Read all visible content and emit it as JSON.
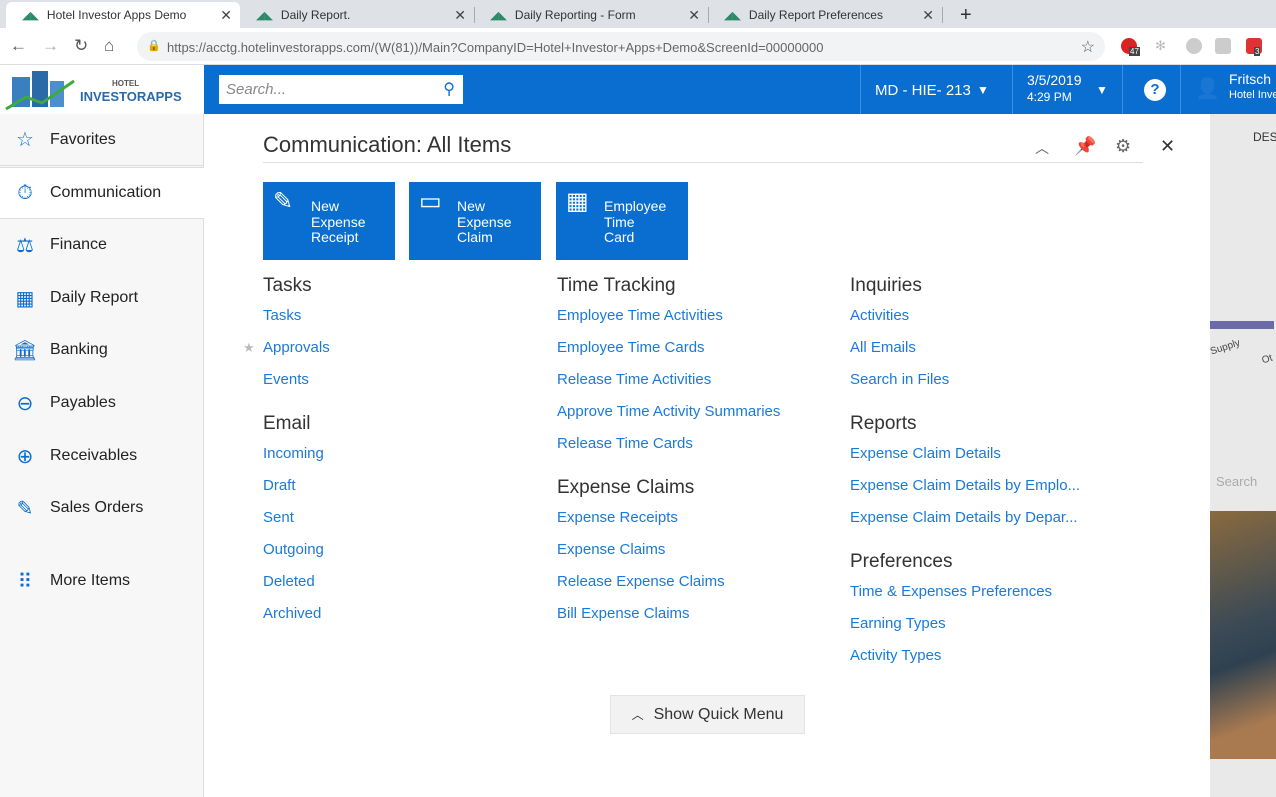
{
  "browser": {
    "tabs": [
      {
        "title": "Hotel Investor Apps Demo",
        "active": true
      },
      {
        "title": "Daily Report."
      },
      {
        "title": "Daily Reporting - Form"
      },
      {
        "title": "Daily Report Preferences"
      }
    ],
    "url_host": "https://acctg.hotelinvestorapps.com",
    "url_rest": "/(W(81))/Main?CompanyID=Hotel+Investor+Apps+Demo&ScreenId=00000000",
    "ext_badges": [
      "47",
      "3"
    ]
  },
  "header": {
    "logo_top": "HOTEL",
    "logo_bottom": "INVESTORAPPS",
    "search_placeholder": "Search...",
    "branch": "MD - HIE- 213",
    "date": "3/5/2019",
    "time": "4:29 PM",
    "user_name": "Fritsch",
    "user_company": "Hotel Inve"
  },
  "sidebar": {
    "items": [
      {
        "label": "Favorites",
        "icon": "star-icon"
      },
      {
        "label": "Communication",
        "icon": "timer-icon"
      },
      {
        "label": "Finance",
        "icon": "scale-icon"
      },
      {
        "label": "Daily Report",
        "icon": "building-icon"
      },
      {
        "label": "Banking",
        "icon": "bank-icon"
      },
      {
        "label": "Payables",
        "icon": "minus-circle-icon"
      },
      {
        "label": "Receivables",
        "icon": "plus-circle-icon"
      },
      {
        "label": "Sales Orders",
        "icon": "edit-icon"
      },
      {
        "label": "More Items",
        "icon": "grid-icon"
      }
    ]
  },
  "panel": {
    "title": "Communication: All Items",
    "tiles": [
      {
        "label": "New Expense Receipt"
      },
      {
        "label": "New Expense Claim"
      },
      {
        "label": "Employee Time Card"
      }
    ],
    "columns": [
      [
        {
          "heading": "Tasks",
          "links": [
            "Tasks",
            "Approvals",
            "Events"
          ]
        },
        {
          "heading": "Email",
          "links": [
            "Incoming",
            "Draft",
            "Sent",
            "Outgoing",
            "Deleted",
            "Archived"
          ]
        }
      ],
      [
        {
          "heading": "Time Tracking",
          "links": [
            "Employee Time Activities",
            "Employee Time Cards",
            "Release Time Activities",
            "Approve Time Activity Summaries",
            "Release Time Cards"
          ]
        },
        {
          "heading": "Expense Claims",
          "links": [
            "Expense Receipts",
            "Expense Claims",
            "Release Expense Claims",
            "Bill Expense Claims"
          ]
        }
      ],
      [
        {
          "heading": "Inquiries",
          "links": [
            "Activities",
            "All Emails",
            "Search in Files"
          ]
        },
        {
          "heading": "Reports",
          "links": [
            "Expense Claim Details",
            "Expense Claim Details by Emplo...",
            "Expense Claim Details by Depar..."
          ]
        },
        {
          "heading": "Preferences",
          "links": [
            "Time & Expenses Preferences",
            "Earning Types",
            "Activity Types"
          ]
        }
      ]
    ],
    "show_quick_menu": "Show Quick Menu"
  },
  "background": {
    "col_header": "DES",
    "label1": "Supply",
    "label2": "Ot",
    "search": "Search"
  }
}
